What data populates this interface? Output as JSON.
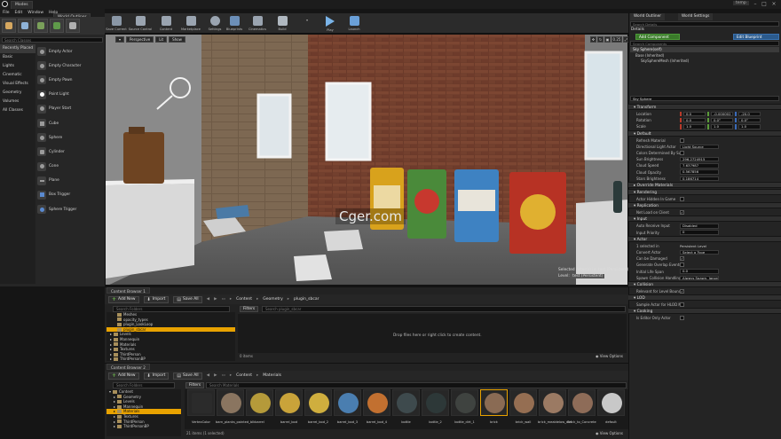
{
  "window": {
    "menu": [
      "File",
      "Edit",
      "Window",
      "Help"
    ],
    "tabs": {
      "modes": "Modes",
      "world_outliner": "World Outliner",
      "world_settings": "World Settings",
      "details": "Details"
    },
    "corner_label": "temp"
  },
  "modes": {
    "search_placeholder": "Search Classes",
    "categories": [
      "Recently Placed",
      "Basic",
      "Lights",
      "Cinematic",
      "Visual Effects",
      "Geometry",
      "Volumes",
      "All Classes"
    ],
    "selected_category": 1,
    "items": [
      "Empty Actor",
      "Empty Character",
      "Empty Pawn",
      "Point Light",
      "Player Start",
      "Cube",
      "Sphere",
      "Cylinder",
      "Cone",
      "Plane",
      "Box Trigger",
      "Sphere Trigger"
    ]
  },
  "toolbar": {
    "buttons": [
      "Save Current",
      "Source Control",
      "Content",
      "Marketplace",
      "Settings",
      "Blueprints",
      "Cinematics",
      "Build",
      "Play",
      "Launch"
    ]
  },
  "viewport": {
    "perspective": "Perspective",
    "lit": "Lit",
    "show": "Show",
    "right_badge": "0.25",
    "status_line1": "Selected Actor(s) in:  test (Persistent)",
    "status_line2_prefix": "Level:",
    "status_line2_value": "test (Persistent)",
    "watermark": "Cger.com"
  },
  "content_browser_1": {
    "tab": "Content Browser 1",
    "add_new": "Add New",
    "import": "Import",
    "save_all": "Save All",
    "breadcrumb": [
      "Content",
      "Geometry",
      "plugin_sbcar"
    ],
    "search_placeholder": "Search Folders",
    "filters": "Filters",
    "asset_search_placeholder": "Search plugin_sbcar",
    "empty_message": "Drop files here or right click to create content.",
    "tree": [
      "Meshes",
      "opacity_types",
      "plugin_LookLoop",
      "plugin_sbcar",
      "Levels",
      "Mannequin",
      "Materials",
      "Textures",
      "ThirdPerson",
      "ThirdPersonBP"
    ],
    "selected_tree_index": 3,
    "item_count": "0 items",
    "view_options": "View Options"
  },
  "content_browser_2": {
    "tab": "Content Browser 2",
    "add_new": "Add New",
    "import": "Import",
    "save_all": "Save All",
    "breadcrumb": [
      "Content",
      "Materials"
    ],
    "search_placeholder": "Search Folders",
    "filters": "Filters",
    "asset_search_placeholder": "Search Materials",
    "tree": [
      "Content",
      "Geometry",
      "Levels",
      "Mannequin",
      "Materials",
      "Textures",
      "ThirdPerson",
      "ThirdPersonBP"
    ],
    "selected_tree_index": 4,
    "assets": [
      {
        "label": "VertexColor",
        "color": "#2a2a2a"
      },
      {
        "label": "barn_planks_painted_blk",
        "color": "#8a7560"
      },
      {
        "label": "barrel",
        "color": "#b59a3a"
      },
      {
        "label": "barrel_bod",
        "color": "#c9a33a"
      },
      {
        "label": "barrel_bod_2",
        "color": "#cfae3e"
      },
      {
        "label": "barrel_bod_3",
        "color": "#4a7eb0"
      },
      {
        "label": "barrel_bod_4",
        "color": "#c27030"
      },
      {
        "label": "bottle",
        "color": "#3e4a4d"
      },
      {
        "label": "bottle_2",
        "color": "#2d3838"
      },
      {
        "label": "bottle_dirt_1",
        "color": "#3f4340"
      },
      {
        "label": "brick",
        "color": "#8a6b54"
      },
      {
        "label": "brick_wall",
        "color": "#956e52"
      },
      {
        "label": "brick_mealdelow_dirt",
        "color": "#9b7a63"
      },
      {
        "label": "Brick_to_Concrete",
        "color": "#8e6c58"
      },
      {
        "label": "default",
        "color": "#c8c8c8"
      }
    ],
    "item_count": "21 items (1 selected)",
    "view_options": "View Options"
  },
  "details": {
    "search_placeholder": "Search Details",
    "actor_name": "Sky Sphere",
    "add_component": "Add Component",
    "edit_blueprint": "Edit Blueprint",
    "search_components": "Search Components",
    "components": [
      "Sky Sphere(self)",
      "Base (Inherited)",
      "SkySphereMesh (Inherited)"
    ],
    "transform": {
      "title": "Transform",
      "location_label": "Location",
      "location": [
        "0.0",
        "-0.000002",
        "-20.0"
      ],
      "rotation_label": "Rotation",
      "rotation": [
        "0.0",
        "0.0°",
        "0.0°"
      ],
      "scale_label": "Scale",
      "scale": [
        "1.0",
        "1.0",
        "1.0"
      ]
    },
    "default": {
      "title": "Default",
      "rows": [
        {
          "label": "Refresh Material",
          "type": "check",
          "value": ""
        },
        {
          "label": "Directional Light Actor",
          "type": "value",
          "value": "Light Source"
        },
        {
          "label": "Colors Determined By Sun Po",
          "type": "check",
          "value": ""
        },
        {
          "label": "Sun Brightness",
          "type": "value",
          "value": "296.2724915"
        },
        {
          "label": "Cloud Speed",
          "type": "value",
          "value": "7.637987"
        },
        {
          "label": "Cloud Opacity",
          "type": "value",
          "value": "0.567856"
        },
        {
          "label": "Stars Brightness",
          "type": "value",
          "value": "0.186714"
        }
      ]
    },
    "override_materials": "Override Materials",
    "rendering": {
      "title": "Rendering",
      "rows": [
        {
          "label": "Actor Hidden In Game",
          "type": "check",
          "value": ""
        }
      ]
    },
    "replication": {
      "title": "Replication",
      "rows": [
        {
          "label": "Net Load on Client",
          "type": "check",
          "value": "on"
        }
      ]
    },
    "input": {
      "title": "Input",
      "rows": [
        {
          "label": "Auto Receive Input",
          "type": "value",
          "value": "Disabled"
        },
        {
          "label": "Input Priority",
          "type": "value",
          "value": "0"
        }
      ]
    },
    "actor": {
      "title": "Actor",
      "rows": [
        {
          "label": "1 selected in",
          "type": "text",
          "value": "Persistent Level"
        },
        {
          "label": "Convert Actor",
          "type": "value",
          "value": "Select a Type"
        },
        {
          "label": "Can be Damaged",
          "type": "check",
          "value": "on"
        },
        {
          "label": "Generate Overlap Events Duri",
          "type": "check",
          "value": ""
        },
        {
          "label": "Initial Life Span",
          "type": "value",
          "value": "0.0"
        },
        {
          "label": "Spawn Collision Handling Met",
          "type": "value",
          "value": "Always Spawn, Ignore Collisions"
        }
      ]
    },
    "collision": {
      "title": "Collision",
      "rows": [
        {
          "label": "Relevant for Level Bounds",
          "type": "check",
          "value": "on"
        }
      ]
    },
    "lod": {
      "title": "LOD",
      "rows": [
        {
          "label": "Sample Actor for HLOD Mesh",
          "type": "check",
          "value": ""
        }
      ]
    },
    "cooking": {
      "title": "Cooking",
      "rows": [
        {
          "label": "Is Editor Only Actor",
          "type": "check",
          "value": ""
        }
      ]
    }
  },
  "colors": {
    "accent": "#e8a200",
    "green": "#6ab04c",
    "blue_button": "#2b5a8c"
  }
}
